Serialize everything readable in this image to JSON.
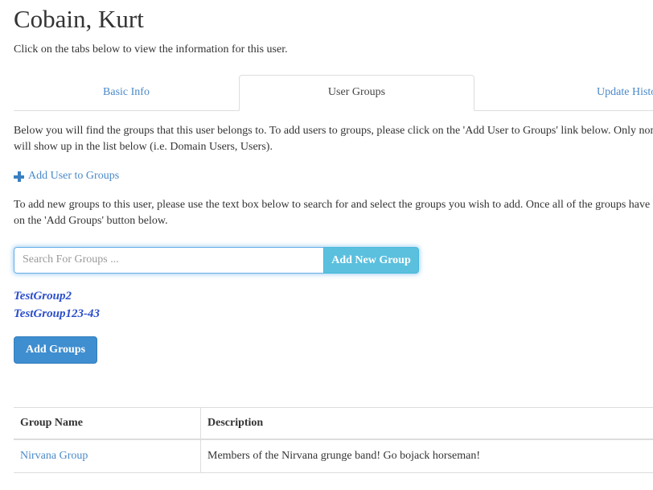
{
  "header": {
    "title": "Cobain, Kurt",
    "intro": "Click on the tabs below to view the information for this user."
  },
  "tabs": [
    {
      "label": "Basic Info",
      "active": false
    },
    {
      "label": "User Groups",
      "active": true
    },
    {
      "label": "Update History",
      "active": false
    }
  ],
  "groups_panel": {
    "description": "Below you will find the groups that this user belongs to. To add users to groups, please click on the 'Add User to Groups' link below. Only non-system generated groups will show up in the list below (i.e. Domain Users, Users).",
    "add_user_link": "Add User to Groups",
    "add_user_icon": "plus-icon",
    "add_groups_description": "To add new groups to this user, please use the text box below to search for and select the groups you wish to add. Once all of the groups have been added, please click on the 'Add Groups' button below.",
    "search": {
      "placeholder": "Search For Groups ...",
      "value": "",
      "add_new_group_label": "Add New Group"
    },
    "selected_groups": [
      "TestGroup2",
      "TestGroup123-43"
    ],
    "add_groups_label": "Add Groups"
  },
  "table": {
    "columns": [
      "Group Name",
      "Description"
    ],
    "rows": [
      {
        "group_name": "Nirvana Group",
        "description": "Members of the Nirvana grunge band! Go bojack horseman!"
      }
    ]
  },
  "colors": {
    "link": "#4a89c8",
    "info_button": "#5bc0de",
    "primary_button": "#3e8ed0",
    "selected_group": "#2b4ecb",
    "text": "#333333",
    "border": "#dddddd",
    "focus_glow": "#66afe9"
  }
}
